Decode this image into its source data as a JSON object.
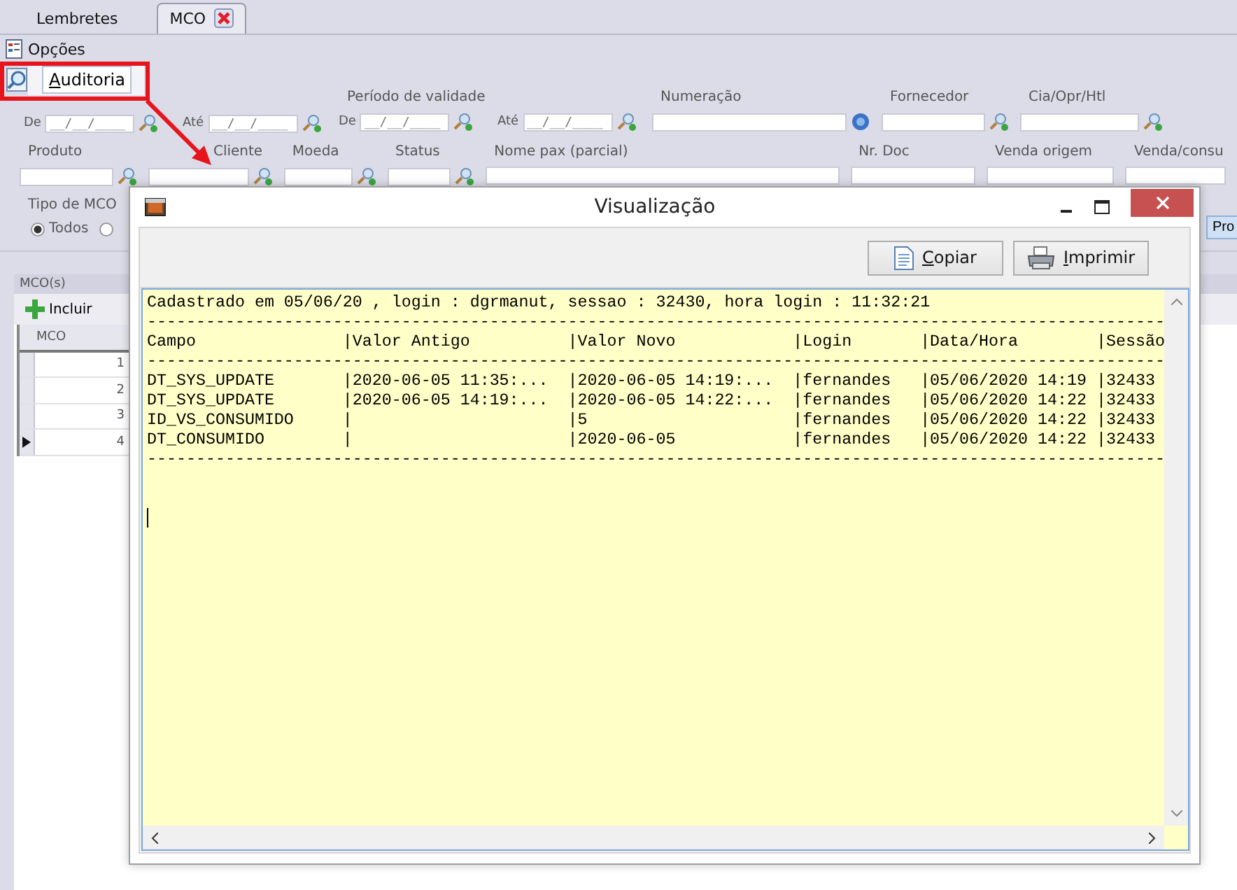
{
  "tabs": [
    {
      "label": "Lembretes",
      "selected": false,
      "closable": false
    },
    {
      "label": "MCO",
      "selected": true,
      "closable": true
    }
  ],
  "menu": {
    "label": "Opções"
  },
  "popup_menu": {
    "items": [
      {
        "label": "Auditoria",
        "selected": true
      }
    ]
  },
  "filter_rows": [
    [
      {
        "kind": "date_range",
        "from": "De",
        "to": "Até",
        "mask": "__/__/____"
      },
      {
        "kind": "date_range",
        "label": "Período de validade",
        "from": "De",
        "to": "Até",
        "mask": "__/__/____"
      },
      {
        "kind": "info",
        "label": "Numeração"
      },
      {
        "kind": "lookup",
        "label": "Fornecedor"
      },
      {
        "kind": "lookup",
        "label": "Cia/Opr/Htl"
      }
    ],
    [
      {
        "kind": "lookup",
        "label": "Produto"
      },
      {
        "kind": "lookup",
        "label": "Cliente"
      },
      {
        "kind": "lookup",
        "label": "Moeda"
      },
      {
        "kind": "lookup",
        "label": "Status"
      },
      {
        "kind": "text",
        "label": "Nome pax (parcial)"
      },
      {
        "kind": "text",
        "label": "Nr. Doc"
      },
      {
        "kind": "text",
        "label": "Venda origem"
      },
      {
        "kind": "text",
        "label": "Venda/consu"
      }
    ]
  ],
  "tipo": {
    "label": "Tipo de MCO",
    "options": [
      {
        "label": "Todos",
        "selected": true
      },
      {
        "selected": false
      }
    ]
  },
  "search_button": {
    "label": "Pro"
  },
  "list": {
    "title": "MCO(s)",
    "add_button": "Incluir",
    "columns": [
      "MCO"
    ],
    "rows": [
      {
        "number": "1",
        "current": false
      },
      {
        "number": "2",
        "current": false
      },
      {
        "number": "3",
        "current": false
      },
      {
        "number": "4",
        "current": true
      }
    ]
  },
  "dialog": {
    "title": "Visualização",
    "buttons": [
      {
        "label": "Copiar"
      },
      {
        "label": "Imprimir"
      }
    ],
    "lines": [
      {
        "kind": "text",
        "text": "Cadastrado em 05/06/20 , login : dgrmanut, sessao : 32430, hora login : 11:32:21"
      },
      {
        "kind": "text",
        "text": "--------------------------------------------------------------------------------------------------------"
      },
      {
        "kind": "row",
        "cells": [
          "Campo",
          "|Valor Antigo",
          "|Valor Novo",
          "|Login",
          "|Data/Hora",
          "|Sessão"
        ]
      },
      {
        "kind": "text",
        "text": "--------------------------------------------------------------------------------------------------------"
      },
      {
        "kind": "row",
        "cells": [
          "DT_SYS_UPDATE",
          "|2020-06-05 11:35:...",
          "|2020-06-05 14:19:...",
          "|fernandes",
          "|05/06/2020 14:19",
          "|32433"
        ]
      },
      {
        "kind": "row",
        "cells": [
          "DT_SYS_UPDATE",
          "|2020-06-05 14:19:...",
          "|2020-06-05 14:22:...",
          "|fernandes",
          "|05/06/2020 14:22",
          "|32433"
        ]
      },
      {
        "kind": "row",
        "cells": [
          "ID_VS_CONSUMIDO",
          "|",
          "|5",
          "|fernandes",
          "|05/06/2020 14:22",
          "|32433"
        ]
      },
      {
        "kind": "row",
        "cells": [
          "DT_CONSUMIDO",
          "|",
          "|2020-06-05",
          "|fernandes",
          "|05/06/2020 14:22",
          "|32433"
        ]
      },
      {
        "kind": "text",
        "text": "--------------------------------------------------------------------------------------------------------"
      }
    ]
  }
}
